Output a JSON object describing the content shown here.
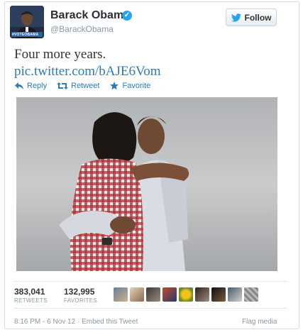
{
  "header": {
    "name": "Barack Obama",
    "handle": "@BarackObama",
    "avatar_badge": "#VOTEOBAMA",
    "verified_icon": "verified-badge-icon",
    "follow_label": "Follow"
  },
  "tweet": {
    "text": "Four more years.",
    "link": "pic.twitter.com/bAJE6Vom"
  },
  "actions": [
    {
      "label": "Reply",
      "icon": "reply-icon"
    },
    {
      "label": "Retweet",
      "icon": "retweet-icon"
    },
    {
      "label": "Favorite",
      "icon": "star-icon"
    }
  ],
  "stats": {
    "retweets_count": "383,041",
    "retweets_label": "RETWEETS",
    "favorites_count": "132,995",
    "favorites_label": "FAVORITES"
  },
  "footer": {
    "timestamp": "8:16 PM - 6 Nov 12",
    "separator": "·",
    "embed_label": "Embed this Tweet",
    "flag_label": "Flag media"
  },
  "colors": {
    "link": "#2b7bb9",
    "verified": "#2aa3ef",
    "muted": "#8899a6"
  }
}
